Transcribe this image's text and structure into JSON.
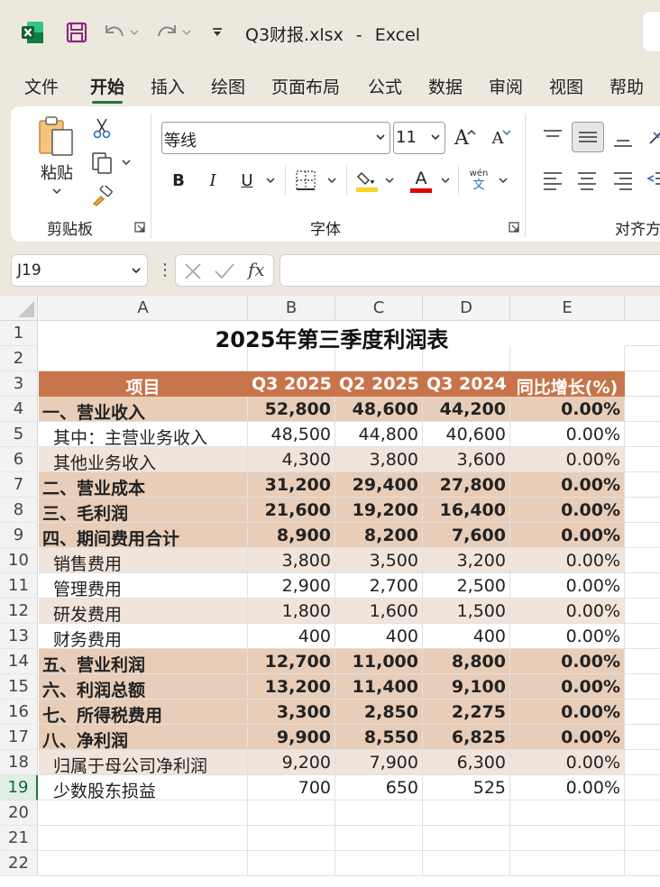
{
  "window": {
    "file_name": "Q3财报.xlsx",
    "separator": "-",
    "app_name": "Excel"
  },
  "ribbon_tabs": [
    {
      "label": "文件",
      "active": false
    },
    {
      "label": "开始",
      "active": true
    },
    {
      "label": "插入",
      "active": false
    },
    {
      "label": "绘图",
      "active": false
    },
    {
      "label": "页面布局",
      "active": false
    },
    {
      "label": "公式",
      "active": false
    },
    {
      "label": "数据",
      "active": false
    },
    {
      "label": "审阅",
      "active": false
    },
    {
      "label": "视图",
      "active": false
    },
    {
      "label": "帮助",
      "active": false
    }
  ],
  "ribbon": {
    "clipboard": {
      "paste_label": "粘贴",
      "group_label": "剪贴板"
    },
    "font": {
      "font_name": "等线",
      "font_size": "11",
      "group_label": "字体",
      "bold": "B",
      "italic": "I",
      "underline": "U",
      "grow": "A",
      "shrink": "A",
      "font_color": "A",
      "phonetic_top": "wén",
      "phonetic_bottom": "文",
      "highlight_color": "#f5d327",
      "font_color_value": "#e00000"
    },
    "alignment": {
      "group_label": "对齐方"
    }
  },
  "formula_bar": {
    "name_box": "J19",
    "fx_label": "fx",
    "formula": ""
  },
  "sheet": {
    "columns": [
      "A",
      "B",
      "C",
      "D",
      "E"
    ],
    "rows": [
      "1",
      "2",
      "3",
      "4",
      "5",
      "6",
      "7",
      "8",
      "9",
      "10",
      "11",
      "12",
      "13",
      "14",
      "15",
      "16",
      "17",
      "18",
      "19",
      "20",
      "21",
      "22"
    ],
    "active_row": "19",
    "title": "2025年第三季度利润表",
    "header": [
      "项目",
      "Q3 2025",
      "Q2 2025",
      "Q3 2024",
      "同比增长(%)"
    ],
    "header_color": "#c8744a",
    "data_rows": [
      {
        "item": "一、营业收入",
        "q3_2025": "52,800",
        "q2_2025": "48,600",
        "q3_2024": "44,200",
        "yoy": "0.00%",
        "style": "major"
      },
      {
        "item": "其中：主营业务收入",
        "q3_2025": "48,500",
        "q2_2025": "44,800",
        "q3_2024": "40,600",
        "yoy": "0.00%",
        "style": "plain"
      },
      {
        "item": "其他业务收入",
        "q3_2025": "4,300",
        "q2_2025": "3,800",
        "q3_2024": "3,600",
        "yoy": "0.00%",
        "style": "light"
      },
      {
        "item": "二、营业成本",
        "q3_2025": "31,200",
        "q2_2025": "29,400",
        "q3_2024": "27,800",
        "yoy": "0.00%",
        "style": "major"
      },
      {
        "item": "三、毛利润",
        "q3_2025": "21,600",
        "q2_2025": "19,200",
        "q3_2024": "16,400",
        "yoy": "0.00%",
        "style": "major"
      },
      {
        "item": "四、期间费用合计",
        "q3_2025": "8,900",
        "q2_2025": "8,200",
        "q3_2024": "7,600",
        "yoy": "0.00%",
        "style": "major"
      },
      {
        "item": "销售费用",
        "q3_2025": "3,800",
        "q2_2025": "3,500",
        "q3_2024": "3,200",
        "yoy": "0.00%",
        "style": "light"
      },
      {
        "item": "管理费用",
        "q3_2025": "2,900",
        "q2_2025": "2,700",
        "q3_2024": "2,500",
        "yoy": "0.00%",
        "style": "plain"
      },
      {
        "item": "研发费用",
        "q3_2025": "1,800",
        "q2_2025": "1,600",
        "q3_2024": "1,500",
        "yoy": "0.00%",
        "style": "light"
      },
      {
        "item": "财务费用",
        "q3_2025": "400",
        "q2_2025": "400",
        "q3_2024": "400",
        "yoy": "0.00%",
        "style": "plain"
      },
      {
        "item": "五、营业利润",
        "q3_2025": "12,700",
        "q2_2025": "11,000",
        "q3_2024": "8,800",
        "yoy": "0.00%",
        "style": "major"
      },
      {
        "item": "六、利润总额",
        "q3_2025": "13,200",
        "q2_2025": "11,400",
        "q3_2024": "9,100",
        "yoy": "0.00%",
        "style": "major"
      },
      {
        "item": "七、所得税费用",
        "q3_2025": "3,300",
        "q2_2025": "2,850",
        "q3_2024": "2,275",
        "yoy": "0.00%",
        "style": "major"
      },
      {
        "item": "八、净利润",
        "q3_2025": "9,900",
        "q2_2025": "8,550",
        "q3_2024": "6,825",
        "yoy": "0.00%",
        "style": "major"
      },
      {
        "item": "归属于母公司净利润",
        "q3_2025": "9,200",
        "q2_2025": "7,900",
        "q3_2024": "6,300",
        "yoy": "0.00%",
        "style": "light"
      },
      {
        "item": "少数股东损益",
        "q3_2025": "700",
        "q2_2025": "650",
        "q3_2024": "525",
        "yoy": "0.00%",
        "style": "plain"
      }
    ],
    "row_fills": {
      "major": "#e8cdb8",
      "light": "#f1e4da",
      "plain": "#ffffff"
    }
  }
}
